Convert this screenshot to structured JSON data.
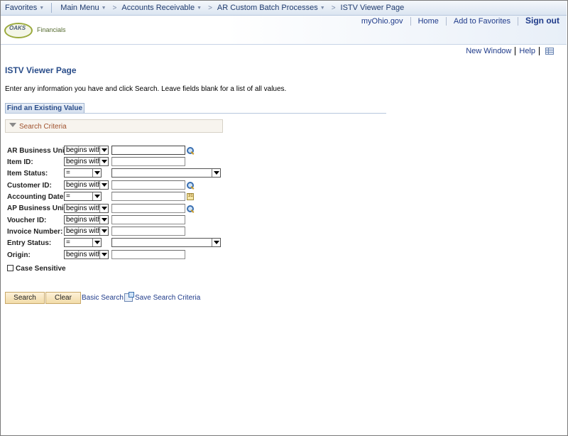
{
  "nav": {
    "favorites": "Favorites",
    "main_menu": "Main Menu",
    "crumbs": [
      "Accounts Receivable",
      "AR Custom Batch Processes",
      "ISTV Viewer Page"
    ]
  },
  "header": {
    "logo_oaks": "OAKS",
    "logo_fin": "Financials",
    "links": [
      "myOhio.gov",
      "Home",
      "Add to Favorites"
    ],
    "sign_out": "Sign out"
  },
  "page_links": {
    "new_window": "New Window",
    "help": "Help"
  },
  "page": {
    "title": "ISTV Viewer Page",
    "instructions": "Enter any information you have and click Search. Leave fields blank for a list of all values.",
    "tab": "Find an Existing Value",
    "criteria_label": "Search Criteria"
  },
  "fields": [
    {
      "label": "AR Business Unit:",
      "op": "begins with"
    },
    {
      "label": "Item ID:",
      "op": "begins with"
    },
    {
      "label": "Item Status:",
      "op": "="
    },
    {
      "label": "Customer ID:",
      "op": "begins with"
    },
    {
      "label": "Accounting Date:",
      "op": "="
    },
    {
      "label": "AP Business Unit:",
      "op": "begins with"
    },
    {
      "label": "Voucher ID:",
      "op": "begins with"
    },
    {
      "label": "Invoice Number:",
      "op": "begins with"
    },
    {
      "label": "Entry Status:",
      "op": "="
    },
    {
      "label": "Origin:",
      "op": "begins with"
    }
  ],
  "calendar_icon_text": "31",
  "case_sensitive": "Case Sensitive",
  "buttons": {
    "search": "Search",
    "clear": "Clear",
    "basic_search": "Basic Search",
    "save_search": "Save Search Criteria"
  }
}
